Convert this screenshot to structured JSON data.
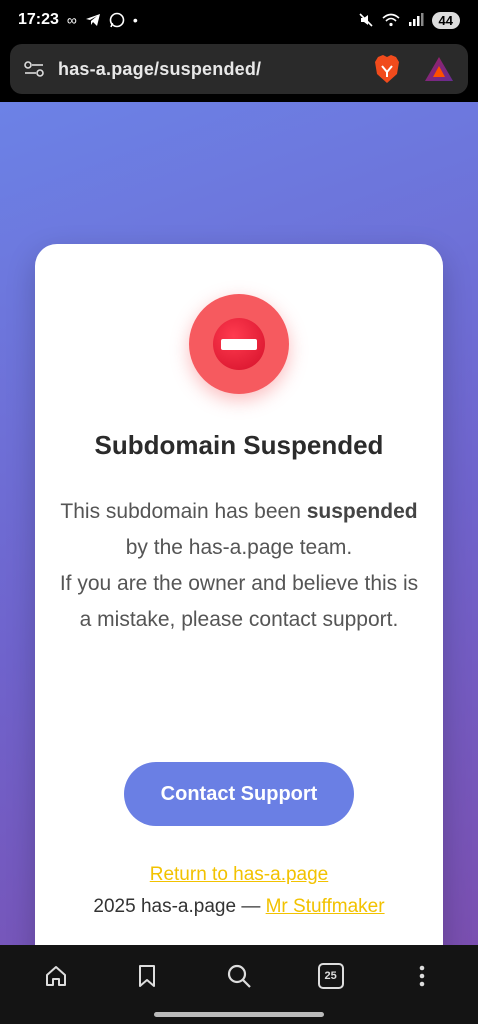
{
  "status_bar": {
    "time": "17:23",
    "battery": "44"
  },
  "browser": {
    "url": "has-a.page/suspended/"
  },
  "page": {
    "title": "Subdomain Suspended",
    "description_part1": "This subdomain has been ",
    "description_bold": "suspended",
    "description_part2": " by the has-a.page team.",
    "description_line2": "If you are the owner and believe this is a mistake, please contact support.",
    "contact_button": "Contact Support",
    "return_link": "Return to has-a.page",
    "footer_prefix": "2025 has-a.page — ",
    "footer_link": "Mr Stuffmaker"
  },
  "bottom_nav": {
    "tab_count": "25"
  },
  "colors": {
    "accent": "#6a7fe4",
    "link": "#f2c200",
    "stop_red": "#f65a5f"
  }
}
